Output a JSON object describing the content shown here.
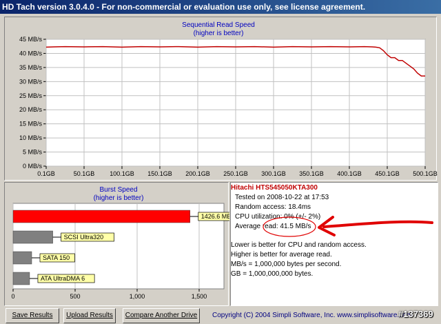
{
  "window": {
    "title": "HD Tach version 3.0.4.0  - For non-commercial or evaluation use only, see license agreement."
  },
  "sequential_chart": {
    "title_line1": "Sequential Read Speed",
    "title_line2": "(higher is better)",
    "y_ticks": [
      "45 MB/s",
      "40 MB/s",
      "35 MB/s",
      "30 MB/s",
      "25 MB/s",
      "20 MB/s",
      "15 MB/s",
      "10 MB/s",
      "5 MB/s",
      "0 MB/s"
    ],
    "x_ticks": [
      "0.1GB",
      "50.1GB",
      "100.1GB",
      "150.1GB",
      "200.1GB",
      "250.1GB",
      "300.1GB",
      "350.1GB",
      "400.1GB",
      "450.1GB",
      "500.1GB"
    ],
    "line_color": "#c00000"
  },
  "burst_chart": {
    "title_line1": "Burst Speed",
    "title_line2": "(higher is better)",
    "x_ticks": [
      "0",
      "500",
      "1,000",
      "1,500"
    ],
    "bar_labels": [
      "1426.6 MB/s",
      "SCSI Ultra320",
      "SATA 150",
      "ATA UltraDMA 6"
    ]
  },
  "info": {
    "drive_name": "Hitachi HTS545050KTA300",
    "tested_on": "Tested on 2008-10-22 at 17:53",
    "random_access": "Random access: 18.4ms",
    "cpu_utilization": "CPU utilization: 0% (+/- 2%)",
    "average_read": "Average read: 41.5 MB/s",
    "note1": "Lower is better for CPU and random access.",
    "note2": "Higher is better for average read.",
    "note3": "MB/s = 1,000,000 bytes per second.",
    "note4": "GB = 1,000,000,000 bytes."
  },
  "buttons": {
    "save": "Save Results",
    "upload": "Upload Results",
    "compare": "Compare Another Drive"
  },
  "footer": {
    "copyright": "Copyright (C) 2004 Simpli Software, Inc. www.simplisoftware.com",
    "watermark": "#137369"
  },
  "chart_data": [
    {
      "type": "line",
      "title": "Sequential Read Speed (higher is better)",
      "xlabel": "",
      "ylabel": "",
      "xlim": [
        0.1,
        500.1
      ],
      "ylim": [
        0,
        45
      ],
      "x_unit": "GB",
      "y_unit": "MB/s",
      "grid": true,
      "series": [
        {
          "x": [
            0.1,
            10,
            25,
            50.1,
            75,
            100.1,
            125,
            150.1,
            175,
            200.1,
            225,
            250.1,
            275,
            300.1,
            325,
            350.1,
            375,
            400.1,
            420,
            430,
            435,
            440,
            445,
            450.1,
            455,
            460,
            465,
            470,
            475,
            480,
            485,
            490,
            495,
            500.1
          ],
          "y": [
            42.2,
            42.3,
            42.4,
            42.3,
            42.4,
            42.2,
            42.4,
            42.3,
            42.4,
            42.2,
            42.4,
            42.3,
            42.4,
            42.2,
            42.4,
            42.3,
            42.4,
            42.3,
            42.4,
            42.3,
            42.2,
            42.0,
            41.0,
            39.5,
            38.5,
            38.5,
            37.5,
            37.5,
            36.5,
            35.5,
            34.5,
            33.0,
            32.0,
            32.0
          ]
        }
      ]
    },
    {
      "type": "bar",
      "title": "Burst Speed (higher is better)",
      "orientation": "horizontal",
      "xlim": [
        0,
        1700
      ],
      "categories": [
        "1426.6 MB/s",
        "SCSI Ultra320",
        "SATA 150",
        "ATA UltraDMA 6"
      ],
      "values": [
        1426.6,
        320,
        150,
        133
      ],
      "colors": [
        "#ff0000",
        "#808080",
        "#808080",
        "#808080"
      ]
    }
  ]
}
